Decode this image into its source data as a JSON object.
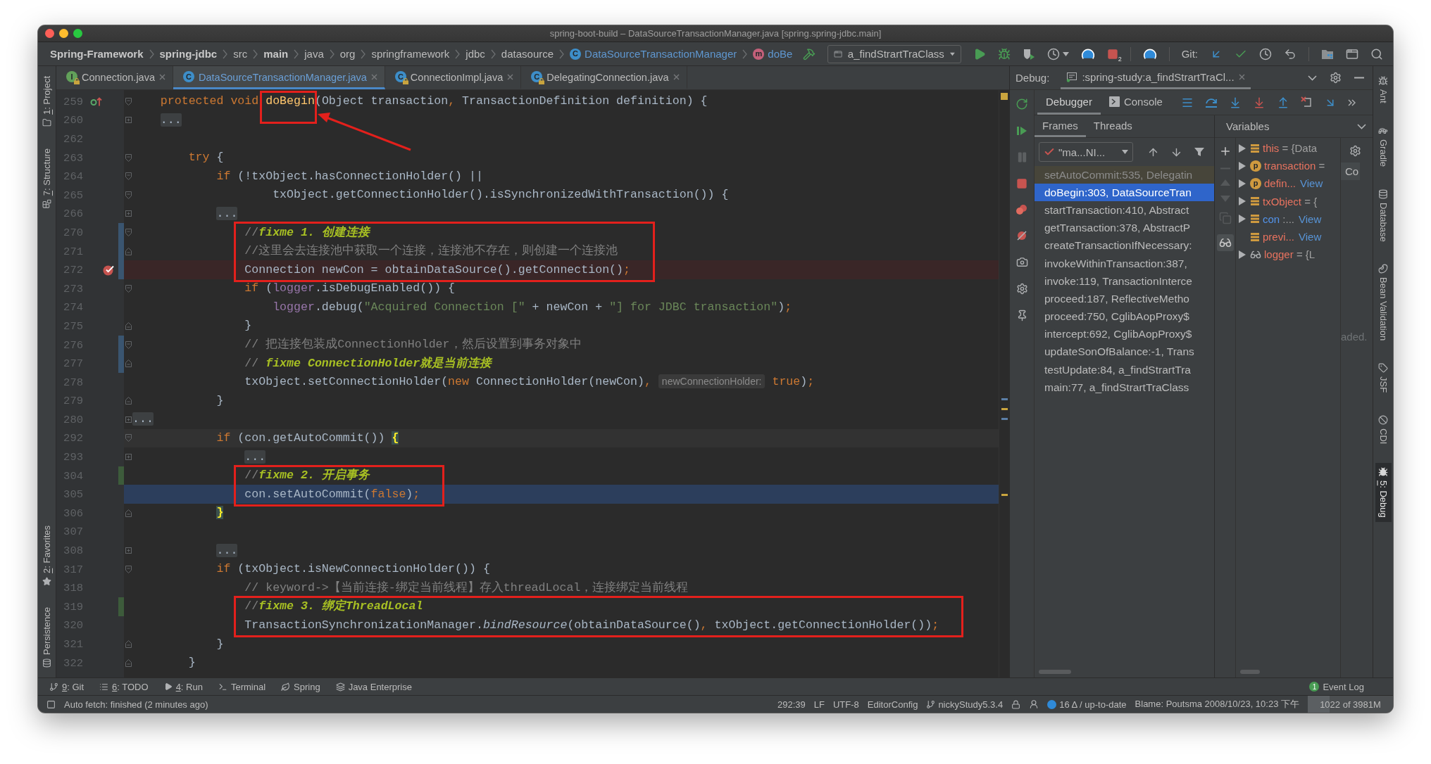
{
  "window": {
    "title": "spring-boot-build – DataSourceTransactionManager.java [spring.spring-jdbc.main]"
  },
  "navbar": {
    "breadcrumbs": [
      {
        "label": "Spring-Framework",
        "kind": "module"
      },
      {
        "label": "spring-jdbc",
        "kind": "module"
      },
      {
        "label": "src",
        "kind": "folder"
      },
      {
        "label": "main",
        "kind": "module"
      },
      {
        "label": "java",
        "kind": "folder"
      },
      {
        "label": "org",
        "kind": "folder"
      },
      {
        "label": "springframework",
        "kind": "folder"
      },
      {
        "label": "jdbc",
        "kind": "folder"
      },
      {
        "label": "datasource",
        "kind": "folder"
      },
      {
        "label": "DataSourceTransactionManager",
        "kind": "class",
        "badge": "C"
      },
      {
        "label": "doBe",
        "kind": "method",
        "badge": "m"
      }
    ],
    "run_configuration": "a_findStrartTraClass",
    "stop_count": "2",
    "vcs_label": "Git:"
  },
  "left_tool_strip": {
    "top": [
      {
        "label": "1: Project",
        "kind": "project",
        "mnemonic": true
      },
      {
        "label": "7: Structure",
        "kind": "structure",
        "mnemonic": true
      }
    ],
    "bottom": [
      {
        "label": "2: Favorites",
        "kind": "favorites",
        "mnemonic": true
      },
      {
        "label": "Persistence",
        "kind": "persistence",
        "mnemonic": false
      }
    ]
  },
  "editor_tabs": [
    {
      "label": "Connection.java",
      "kind": "interface",
      "badge": "I",
      "read_only": true,
      "modified": false,
      "selected": false
    },
    {
      "label": "DataSourceTransactionManager.java",
      "kind": "class",
      "badge": "C",
      "read_only": false,
      "modified": true,
      "selected": true
    },
    {
      "label": "ConnectionImpl.java",
      "kind": "class",
      "badge": "C",
      "read_only": true,
      "modified": false,
      "selected": false
    },
    {
      "label": "DelegatingConnection.java",
      "kind": "class",
      "badge": "C",
      "read_only": true,
      "modified": false,
      "selected": false
    }
  ],
  "editor": {
    "lines": [
      {
        "number": "259",
        "fold": {
          "kind": "open"
        },
        "gutter_icon": {
          "kind": "override"
        },
        "tokens": [
          {
            "kind": "keyword",
            "text": "    protected void "
          },
          {
            "kind": "method",
            "text": "doBegin",
            "boxed": true,
            "callout": {
              "kind": "arrow"
            }
          },
          {
            "kind": "plain",
            "text": "(Object transaction"
          },
          {
            "kind": "punct",
            "text": ","
          },
          {
            "kind": "plain",
            "text": " TransactionDefinition definition) {"
          }
        ]
      },
      {
        "number": "260",
        "fold": {
          "kind": "closed"
        },
        "tokens": [
          {
            "kind": "fold",
            "text": "    ..."
          }
        ]
      },
      {
        "number": "262"
      },
      {
        "number": "263",
        "fold": {
          "kind": "open"
        },
        "tokens": [
          {
            "kind": "keyword",
            "text": "        try"
          },
          {
            "kind": "plain",
            "text": " {"
          }
        ]
      },
      {
        "number": "264",
        "fold": {
          "kind": "open"
        },
        "tokens": [
          {
            "kind": "keyword",
            "text": "            if"
          },
          {
            "kind": "plain",
            "text": " (!txObject.hasConnectionHolder() ||"
          }
        ]
      },
      {
        "number": "265",
        "fold": {
          "kind": "open"
        },
        "tokens": [
          {
            "kind": "plain",
            "text": "                    txObject.getConnectionHolder().isSynchronizedWithTransaction()) {"
          }
        ]
      },
      {
        "number": "266",
        "fold": {
          "kind": "closed"
        },
        "tokens": [
          {
            "kind": "fold",
            "text": "            ..."
          }
        ]
      },
      {
        "number": "270",
        "fold": {
          "kind": "open"
        },
        "change": {
          "kind": "modified"
        },
        "boxed": true,
        "tokens": [
          {
            "kind": "comment",
            "text": "                //"
          },
          {
            "kind": "todo",
            "text": "fixme 1. 创建连接"
          }
        ]
      },
      {
        "number": "271",
        "fold": {
          "kind": "end"
        },
        "change": {
          "kind": "modified"
        },
        "boxed": true,
        "tokens": [
          {
            "kind": "comment",
            "text": "                //这里会去连接池中获取一个连接，连接池不存在，则创建一个连接池"
          }
        ]
      },
      {
        "number": "272",
        "gutter_icon": {
          "kind": "breakpoint"
        },
        "highlight": {
          "kind": "breakpoint"
        },
        "change": {
          "kind": "modified"
        },
        "boxed": true,
        "tokens": [
          {
            "kind": "plain",
            "text": "                Connection newCon = obtainDataSource().getConnection()"
          },
          {
            "kind": "punct",
            "text": ";"
          }
        ]
      },
      {
        "number": "273",
        "fold": {
          "kind": "open"
        },
        "tokens": [
          {
            "kind": "keyword",
            "text": "                if"
          },
          {
            "kind": "plain",
            "text": " ("
          },
          {
            "kind": "field",
            "text": "logger"
          },
          {
            "kind": "plain",
            "text": ".isDebugEnabled()) {"
          }
        ]
      },
      {
        "number": "274",
        "tokens": [
          {
            "kind": "field",
            "text": "                    logger"
          },
          {
            "kind": "plain",
            "text": ".debug("
          },
          {
            "kind": "string",
            "text": "\"Acquired Connection [\""
          },
          {
            "kind": "plain",
            "text": " + newCon + "
          },
          {
            "kind": "string",
            "text": "\"] for JDBC transaction\""
          },
          {
            "kind": "plain",
            "text": ")"
          },
          {
            "kind": "punct",
            "text": ";"
          }
        ]
      },
      {
        "number": "275",
        "fold": {
          "kind": "end"
        },
        "tokens": [
          {
            "kind": "plain",
            "text": "                }"
          }
        ]
      },
      {
        "number": "276",
        "fold": {
          "kind": "open"
        },
        "change": {
          "kind": "modified"
        },
        "tokens": [
          {
            "kind": "comment",
            "text": "                // 把连接包装成ConnectionHolder，然后设置到事务对象中"
          }
        ]
      },
      {
        "number": "277",
        "fold": {
          "kind": "end"
        },
        "change": {
          "kind": "modified"
        },
        "tokens": [
          {
            "kind": "comment",
            "text": "                // "
          },
          {
            "kind": "todo",
            "text": "fixme ConnectionHolder就是当前连接"
          }
        ]
      },
      {
        "number": "278",
        "tokens": [
          {
            "kind": "plain",
            "text": "                txObject.setConnectionHolder("
          },
          {
            "kind": "keyword",
            "text": "new"
          },
          {
            "kind": "plain",
            "text": " ConnectionHolder(newCon)"
          },
          {
            "kind": "punct",
            "text": ", "
          },
          {
            "kind": "hint",
            "text": "newConnectionHolder:"
          },
          {
            "kind": "keyword",
            "text": " true"
          },
          {
            "kind": "plain",
            "text": ")"
          },
          {
            "kind": "punct",
            "text": ";"
          }
        ]
      },
      {
        "number": "279",
        "fold": {
          "kind": "end"
        },
        "tokens": [
          {
            "kind": "plain",
            "text": "            }"
          }
        ]
      },
      {
        "number": "280",
        "fold": {
          "kind": "closed"
        },
        "tokens": [
          {
            "kind": "fold",
            "text": "..."
          }
        ]
      },
      {
        "number": "292",
        "fold": {
          "kind": "open"
        },
        "highlight": {
          "kind": "caret"
        },
        "tokens": [
          {
            "kind": "keyword",
            "text": "            if"
          },
          {
            "kind": "plain",
            "text": " (con.getAutoCommit()) "
          },
          {
            "kind": "brace",
            "text": "{"
          }
        ]
      },
      {
        "number": "293",
        "fold": {
          "kind": "closed"
        },
        "tokens": [
          {
            "kind": "fold",
            "text": "                ..."
          }
        ]
      },
      {
        "number": "304",
        "change": {
          "kind": "added"
        },
        "boxed": true,
        "tokens": [
          {
            "kind": "comment",
            "text": "                //"
          },
          {
            "kind": "todo",
            "text": "fixme 2. 开启事务"
          }
        ]
      },
      {
        "number": "305",
        "highlight": {
          "kind": "execution"
        },
        "boxed": true,
        "tokens": [
          {
            "kind": "plain",
            "text": "                con.setAutoCommit("
          },
          {
            "kind": "keyword",
            "text": "false"
          },
          {
            "kind": "plain",
            "text": ")"
          },
          {
            "kind": "punct",
            "text": ";"
          }
        ]
      },
      {
        "number": "306",
        "fold": {
          "kind": "end"
        },
        "tokens": [
          {
            "kind": "brace",
            "text": "            }"
          }
        ]
      },
      {
        "number": "307"
      },
      {
        "number": "308",
        "fold": {
          "kind": "closed"
        },
        "tokens": [
          {
            "kind": "fold",
            "text": "            ..."
          }
        ]
      },
      {
        "number": "317",
        "fold": {
          "kind": "open"
        },
        "tokens": [
          {
            "kind": "keyword",
            "text": "            if"
          },
          {
            "kind": "plain",
            "text": " (txObject.isNewConnectionHolder()) {"
          }
        ]
      },
      {
        "number": "318",
        "tokens": [
          {
            "kind": "comment",
            "text": "                // keyword->【当前连接-绑定当前线程】存入threadLocal，连接绑定当前线程"
          }
        ]
      },
      {
        "number": "319",
        "change": {
          "kind": "added"
        },
        "boxed": true,
        "tokens": [
          {
            "kind": "comment",
            "text": "                //"
          },
          {
            "kind": "todo",
            "text": "fixme 3. 绑定ThreadLocal"
          }
        ]
      },
      {
        "number": "320",
        "boxed": true,
        "tokens": [
          {
            "kind": "plain",
            "text": "                TransactionSynchronizationManager."
          },
          {
            "kind": "italic",
            "text": "bindResource"
          },
          {
            "kind": "plain",
            "text": "(obtainDataSource()"
          },
          {
            "kind": "punct",
            "text": ","
          },
          {
            "kind": "plain",
            "text": " txObject.getConnectionHolder())"
          },
          {
            "kind": "punct",
            "text": ";"
          }
        ]
      },
      {
        "number": "321",
        "fold": {
          "kind": "end"
        },
        "tokens": [
          {
            "kind": "plain",
            "text": "            }"
          }
        ]
      },
      {
        "number": "322",
        "fold": {
          "kind": "end"
        },
        "tokens": [
          {
            "kind": "plain",
            "text": "        }"
          }
        ]
      }
    ]
  },
  "debug": {
    "label": "Debug:",
    "session": ":spring-study:a_findStrartTraCl...",
    "tabs": [
      {
        "label": "Debugger",
        "kind": "debugger",
        "selected": true
      },
      {
        "label": "Console",
        "kind": "console",
        "selected": false
      }
    ],
    "frames_tabs": [
      {
        "label": "Frames",
        "selected": true
      },
      {
        "label": "Threads",
        "selected": false
      }
    ],
    "thread": "\"ma...NI...",
    "frames": [
      {
        "label": "setAutoCommit:535, Delegatin",
        "kind": "library",
        "selected": false
      },
      {
        "label": "doBegin:303, DataSourceTran",
        "kind": "frame",
        "selected": true
      },
      {
        "label": "startTransaction:410, Abstract",
        "kind": "frame",
        "selected": false
      },
      {
        "label": "getTransaction:378, AbstractP",
        "kind": "frame",
        "selected": false
      },
      {
        "label": "createTransactionIfNecessary:",
        "kind": "frame",
        "selected": false
      },
      {
        "label": "invokeWithinTransaction:387,",
        "kind": "frame",
        "selected": false
      },
      {
        "label": "invoke:119, TransactionInterce",
        "kind": "frame",
        "selected": false
      },
      {
        "label": "proceed:187, ReflectiveMetho",
        "kind": "frame",
        "selected": false
      },
      {
        "label": "proceed:750, CglibAopProxy$",
        "kind": "frame",
        "selected": false
      },
      {
        "label": "intercept:692, CglibAopProxy$",
        "kind": "frame",
        "selected": false
      },
      {
        "label": "updateSonOfBalance:-1, Trans",
        "kind": "frame",
        "selected": false
      },
      {
        "label": "testUpdate:84, a_findStrartTra",
        "kind": "frame",
        "selected": false
      },
      {
        "label": "main:77, a_findStrartTraClass",
        "kind": "frame",
        "selected": false
      }
    ],
    "variables_title": "Variables",
    "variables": [
      {
        "name": "this",
        "value": "= {Data",
        "kind": "field",
        "expandable": true,
        "color": "#e8735f"
      },
      {
        "name": "transaction",
        "value": "=",
        "kind": "parameter",
        "badge": "p",
        "expandable": true,
        "color": "#e8735f"
      },
      {
        "name": "defin...",
        "link": "View",
        "kind": "parameter",
        "badge": "p",
        "expandable": true,
        "color": "#e8735f"
      },
      {
        "name": "txObject",
        "value": "= {",
        "kind": "field",
        "expandable": true,
        "color": "#e8735f"
      },
      {
        "name": "con",
        "value": ":...",
        "link": "View",
        "kind": "field",
        "expandable": true,
        "color": "#5394ec"
      },
      {
        "name": "previ...",
        "link": "View",
        "kind": "field",
        "expandable": false,
        "color": "#e8735f"
      },
      {
        "name": "logger",
        "value": "= {L",
        "kind": "watch",
        "expandable": true,
        "color": "#e8735f"
      }
    ],
    "side_label": "Co",
    "side_note": "aded."
  },
  "right_tool_strip": [
    {
      "label": "Ant",
      "kind": "ant",
      "mnemonic": false,
      "selected": false
    },
    {
      "label": "Gradle",
      "kind": "gradle",
      "mnemonic": false,
      "selected": false
    },
    {
      "label": "Database",
      "kind": "database",
      "mnemonic": false,
      "selected": false
    },
    {
      "label": "Bean Validation",
      "kind": "bean-validation",
      "mnemonic": false,
      "selected": false
    },
    {
      "label": "JSF",
      "kind": "jsf",
      "mnemonic": false,
      "selected": false
    },
    {
      "label": "CDI",
      "kind": "cdi",
      "mnemonic": false,
      "selected": false
    },
    {
      "label": "5: Debug",
      "kind": "debug",
      "mnemonic": true,
      "selected": true
    }
  ],
  "bottom_tools": {
    "items": [
      {
        "label": "9: Git",
        "kind": "git",
        "mnemonic": true
      },
      {
        "label": "6: TODO",
        "kind": "todo",
        "mnemonic": true
      },
      {
        "label": "4: Run",
        "kind": "run",
        "mnemonic": true
      },
      {
        "label": "Terminal",
        "kind": "terminal",
        "mnemonic": false
      },
      {
        "label": "Spring",
        "kind": "spring",
        "mnemonic": false
      },
      {
        "label": "Java Enterprise",
        "kind": "java-enterprise",
        "mnemonic": false
      }
    ],
    "event_log": {
      "label": "Event Log",
      "count": "1"
    }
  },
  "status_bar": {
    "message": "Auto fetch: finished (2 minutes ago)",
    "caret": "292:39",
    "line_separator": "LF",
    "encoding": "UTF-8",
    "editor_config": "EditorConfig",
    "branch": "nickyStudy5.3.4",
    "vcs_status": "16 Δ / up-to-date",
    "blame": "Blame: Poutsma 2008/10/23, 10:23 下午",
    "memory": {
      "label": "1022 of 3981M",
      "level": 0.26
    }
  }
}
